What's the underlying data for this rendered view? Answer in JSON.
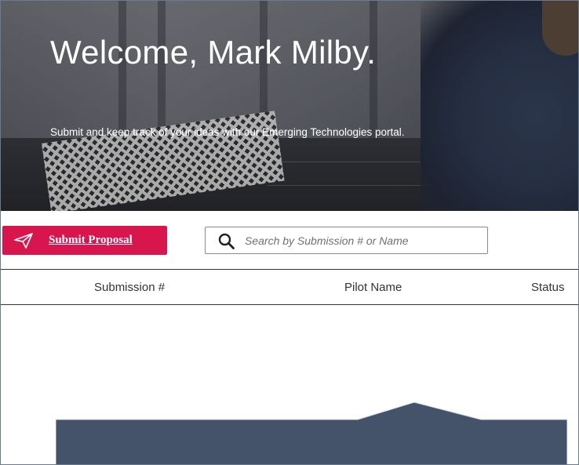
{
  "hero": {
    "title": "Welcome, Mark Milby.",
    "subtitle": "Submit and keep track of your ideas with our Emerging Technologies portal."
  },
  "toolbar": {
    "submit_label": "Submit Proposal",
    "submit_icon": "paper-plane-icon",
    "search_icon": "search-icon",
    "search_placeholder": "Search by Submission # or Name",
    "search_value": ""
  },
  "table": {
    "columns": [
      "Submission #",
      "Pilot Name",
      "Status"
    ],
    "rows": []
  },
  "colors": {
    "accent": "#d8154c",
    "panel": "#45536a",
    "text": "#333333"
  }
}
